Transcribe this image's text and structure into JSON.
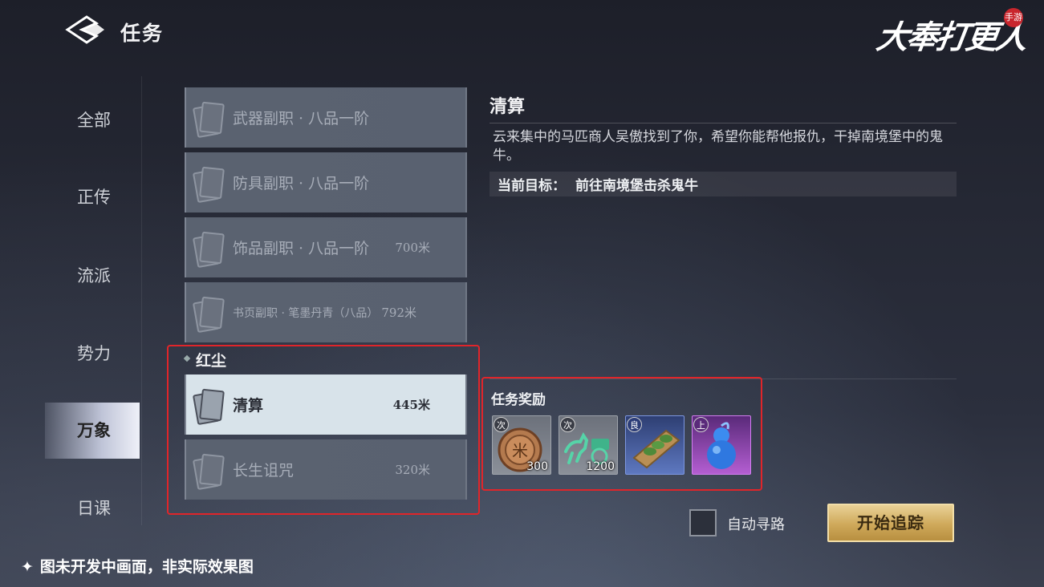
{
  "header": {
    "title": "任务"
  },
  "logo": {
    "text": "大奉打更人",
    "badge": "手游"
  },
  "categories": [
    {
      "label": "全部",
      "active": false
    },
    {
      "label": "正传",
      "active": false
    },
    {
      "label": "流派",
      "active": false
    },
    {
      "label": "势力",
      "active": false
    },
    {
      "label": "万象",
      "active": true
    },
    {
      "label": "日课",
      "active": false
    }
  ],
  "quests": [
    {
      "name": "武器副职 · 八品一阶",
      "distance": ""
    },
    {
      "name": "防具副职 · 八品一阶",
      "distance": ""
    },
    {
      "name": "饰品副职 · 八品一阶",
      "distance": "700米"
    },
    {
      "name": "书页副职 · 笔墨丹青（八品）",
      "distance": "792米"
    }
  ],
  "group": {
    "label": "红尘",
    "quests": [
      {
        "name": "清算",
        "distance": "445米",
        "selected": true
      },
      {
        "name": "长生诅咒",
        "distance": "320米",
        "selected": false
      }
    ]
  },
  "detail": {
    "title": "清算",
    "description": "云来集中的马匹商人吴傲找到了你，希望你能帮他报仇，干掉南境堡中的鬼牛。",
    "objective_label": "当前目标：",
    "objective_value": "前往南境堡击杀鬼牛",
    "rewards_title": "任务奖励",
    "rewards": [
      {
        "name": "coin",
        "grade": "次",
        "count": "300"
      },
      {
        "name": "horse-carriage",
        "grade": "次",
        "count": "1200"
      },
      {
        "name": "jade-tablet",
        "grade": "良",
        "count": ""
      },
      {
        "name": "blue-gourd",
        "grade": "上",
        "count": ""
      }
    ]
  },
  "controls": {
    "auto_path_label": "自动寻路",
    "track_button": "开始追踪"
  },
  "footer": {
    "note": "图未开发中画面，非实际效果图",
    "star": "✦"
  },
  "colors": {
    "highlight": "#e0252a",
    "gold_button": "#cfa95a",
    "selected_item": "#d8e3ea"
  }
}
